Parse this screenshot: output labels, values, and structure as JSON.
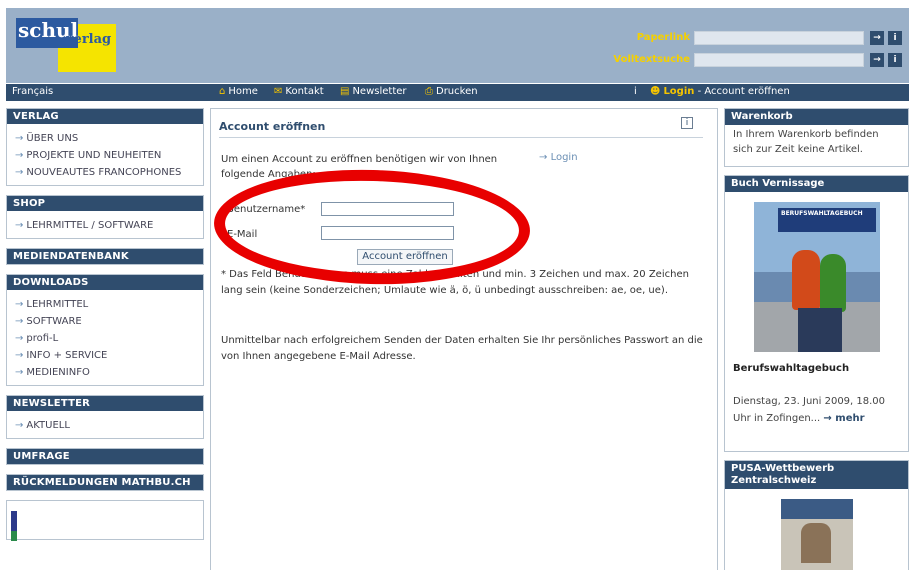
{
  "brand": {
    "logo_main": "schul",
    "logo_sub": "verlag"
  },
  "header": {
    "paperlink_label": "Paperlink",
    "search_label": "Volltextsuche",
    "go_glyph": "→",
    "info_glyph": "i"
  },
  "nav": {
    "language": "Français",
    "items": [
      {
        "label": "Home",
        "icon": "house-icon",
        "glyph": "⌂"
      },
      {
        "label": "Kontakt",
        "icon": "mail-icon",
        "glyph": "✉"
      },
      {
        "label": "Newsletter",
        "icon": "newsletter-icon",
        "glyph": "▤"
      },
      {
        "label": "Drucken",
        "icon": "printer-icon",
        "glyph": "⎙"
      }
    ],
    "login": "Login",
    "breadcrumb": "- Account eröffnen"
  },
  "sidebar": {
    "verlag": {
      "title": "VERLAG",
      "items": [
        "ÜBER UNS",
        "PROJEKTE UND NEUHEITEN",
        "NOUVEAUTES FRANCOPHONES"
      ]
    },
    "shop": {
      "title": "SHOP",
      "items": [
        "LEHRMITTEL / SOFTWARE"
      ]
    },
    "mediendatenbank": {
      "title": "MEDIENDATENBANK"
    },
    "downloads": {
      "title": "DOWNLOADS",
      "items": [
        "LEHRMITTEL",
        "SOFTWARE",
        "profi-L",
        "INFO + SERVICE",
        "MEDIENINFO"
      ]
    },
    "newsletter": {
      "title": "NEWSLETTER",
      "items": [
        "AKTUELL"
      ]
    },
    "umfrage": {
      "title": "UMFRAGE"
    },
    "rueckmeldungen": {
      "title": "RÜCKMELDUNGEN MATHBU.CH"
    }
  },
  "main": {
    "title": "Account eröffnen",
    "intro": "Um einen Account zu eröffnen benötigen wir von Ihnen folgende Angaben:",
    "login_link": "Login",
    "fields": {
      "username_label": "Benutzername*",
      "username_value": "",
      "email_label": "E-Mail",
      "email_value": ""
    },
    "submit_label": "Account eröffnen",
    "note": "* Das Feld Benutzername muss eine Zahl enthalten und min. 3 Zeichen und max. 20 Zeichen lang sein (keine Sonderzeichen; Umlaute wie ä, ö, ü unbedingt ausschreiben: ae, oe, ue).",
    "note2": "Unmittelbar nach erfolgreichem Senden der Daten erhalten Sie Ihr persönliches Passwort an die von Ihnen angegebene E-Mail Adresse."
  },
  "right": {
    "warenkorb": {
      "title": "Warenkorb",
      "text": "In Ihrem Warenkorb befinden sich zur Zeit keine Artikel."
    },
    "vernissage": {
      "title": "Buch Vernissage",
      "image_caption": "BERUFSWAHLTAGEBUCH",
      "book": "Berufswahltagebuch",
      "date_text": "Dienstag, 23. Juni 2009, 18.00 Uhr in Zofingen...",
      "more": "mehr"
    },
    "pusa": {
      "title": "PUSA-Wettbewerb Zentralschweiz"
    }
  },
  "colors": {
    "accent": "#2f4d6e",
    "header": "#9ab0c8",
    "highlight": "#f5c400",
    "annotation": "#e80000"
  }
}
